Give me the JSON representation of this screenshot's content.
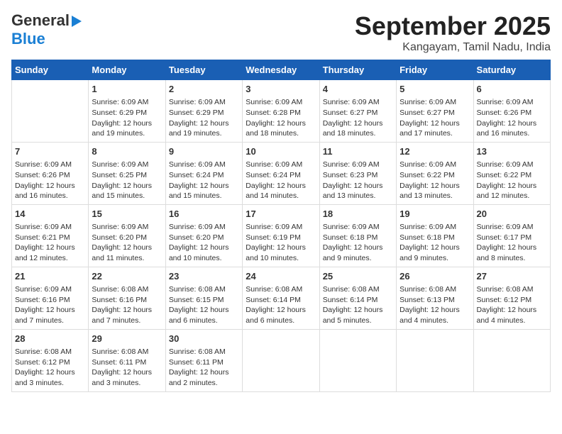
{
  "logo": {
    "part1": "General",
    "part2": "Blue"
  },
  "title": "September 2025",
  "location": "Kangayam, Tamil Nadu, India",
  "days_header": [
    "Sunday",
    "Monday",
    "Tuesday",
    "Wednesday",
    "Thursday",
    "Friday",
    "Saturday"
  ],
  "weeks": [
    [
      {
        "day": "",
        "info": ""
      },
      {
        "day": "1",
        "info": "Sunrise: 6:09 AM\nSunset: 6:29 PM\nDaylight: 12 hours\nand 19 minutes."
      },
      {
        "day": "2",
        "info": "Sunrise: 6:09 AM\nSunset: 6:29 PM\nDaylight: 12 hours\nand 19 minutes."
      },
      {
        "day": "3",
        "info": "Sunrise: 6:09 AM\nSunset: 6:28 PM\nDaylight: 12 hours\nand 18 minutes."
      },
      {
        "day": "4",
        "info": "Sunrise: 6:09 AM\nSunset: 6:27 PM\nDaylight: 12 hours\nand 18 minutes."
      },
      {
        "day": "5",
        "info": "Sunrise: 6:09 AM\nSunset: 6:27 PM\nDaylight: 12 hours\nand 17 minutes."
      },
      {
        "day": "6",
        "info": "Sunrise: 6:09 AM\nSunset: 6:26 PM\nDaylight: 12 hours\nand 16 minutes."
      }
    ],
    [
      {
        "day": "7",
        "info": "Sunrise: 6:09 AM\nSunset: 6:26 PM\nDaylight: 12 hours\nand 16 minutes."
      },
      {
        "day": "8",
        "info": "Sunrise: 6:09 AM\nSunset: 6:25 PM\nDaylight: 12 hours\nand 15 minutes."
      },
      {
        "day": "9",
        "info": "Sunrise: 6:09 AM\nSunset: 6:24 PM\nDaylight: 12 hours\nand 15 minutes."
      },
      {
        "day": "10",
        "info": "Sunrise: 6:09 AM\nSunset: 6:24 PM\nDaylight: 12 hours\nand 14 minutes."
      },
      {
        "day": "11",
        "info": "Sunrise: 6:09 AM\nSunset: 6:23 PM\nDaylight: 12 hours\nand 13 minutes."
      },
      {
        "day": "12",
        "info": "Sunrise: 6:09 AM\nSunset: 6:22 PM\nDaylight: 12 hours\nand 13 minutes."
      },
      {
        "day": "13",
        "info": "Sunrise: 6:09 AM\nSunset: 6:22 PM\nDaylight: 12 hours\nand 12 minutes."
      }
    ],
    [
      {
        "day": "14",
        "info": "Sunrise: 6:09 AM\nSunset: 6:21 PM\nDaylight: 12 hours\nand 12 minutes."
      },
      {
        "day": "15",
        "info": "Sunrise: 6:09 AM\nSunset: 6:20 PM\nDaylight: 12 hours\nand 11 minutes."
      },
      {
        "day": "16",
        "info": "Sunrise: 6:09 AM\nSunset: 6:20 PM\nDaylight: 12 hours\nand 10 minutes."
      },
      {
        "day": "17",
        "info": "Sunrise: 6:09 AM\nSunset: 6:19 PM\nDaylight: 12 hours\nand 10 minutes."
      },
      {
        "day": "18",
        "info": "Sunrise: 6:09 AM\nSunset: 6:18 PM\nDaylight: 12 hours\nand 9 minutes."
      },
      {
        "day": "19",
        "info": "Sunrise: 6:09 AM\nSunset: 6:18 PM\nDaylight: 12 hours\nand 9 minutes."
      },
      {
        "day": "20",
        "info": "Sunrise: 6:09 AM\nSunset: 6:17 PM\nDaylight: 12 hours\nand 8 minutes."
      }
    ],
    [
      {
        "day": "21",
        "info": "Sunrise: 6:09 AM\nSunset: 6:16 PM\nDaylight: 12 hours\nand 7 minutes."
      },
      {
        "day": "22",
        "info": "Sunrise: 6:08 AM\nSunset: 6:16 PM\nDaylight: 12 hours\nand 7 minutes."
      },
      {
        "day": "23",
        "info": "Sunrise: 6:08 AM\nSunset: 6:15 PM\nDaylight: 12 hours\nand 6 minutes."
      },
      {
        "day": "24",
        "info": "Sunrise: 6:08 AM\nSunset: 6:14 PM\nDaylight: 12 hours\nand 6 minutes."
      },
      {
        "day": "25",
        "info": "Sunrise: 6:08 AM\nSunset: 6:14 PM\nDaylight: 12 hours\nand 5 minutes."
      },
      {
        "day": "26",
        "info": "Sunrise: 6:08 AM\nSunset: 6:13 PM\nDaylight: 12 hours\nand 4 minutes."
      },
      {
        "day": "27",
        "info": "Sunrise: 6:08 AM\nSunset: 6:12 PM\nDaylight: 12 hours\nand 4 minutes."
      }
    ],
    [
      {
        "day": "28",
        "info": "Sunrise: 6:08 AM\nSunset: 6:12 PM\nDaylight: 12 hours\nand 3 minutes."
      },
      {
        "day": "29",
        "info": "Sunrise: 6:08 AM\nSunset: 6:11 PM\nDaylight: 12 hours\nand 3 minutes."
      },
      {
        "day": "30",
        "info": "Sunrise: 6:08 AM\nSunset: 6:11 PM\nDaylight: 12 hours\nand 2 minutes."
      },
      {
        "day": "",
        "info": ""
      },
      {
        "day": "",
        "info": ""
      },
      {
        "day": "",
        "info": ""
      },
      {
        "day": "",
        "info": ""
      }
    ]
  ]
}
